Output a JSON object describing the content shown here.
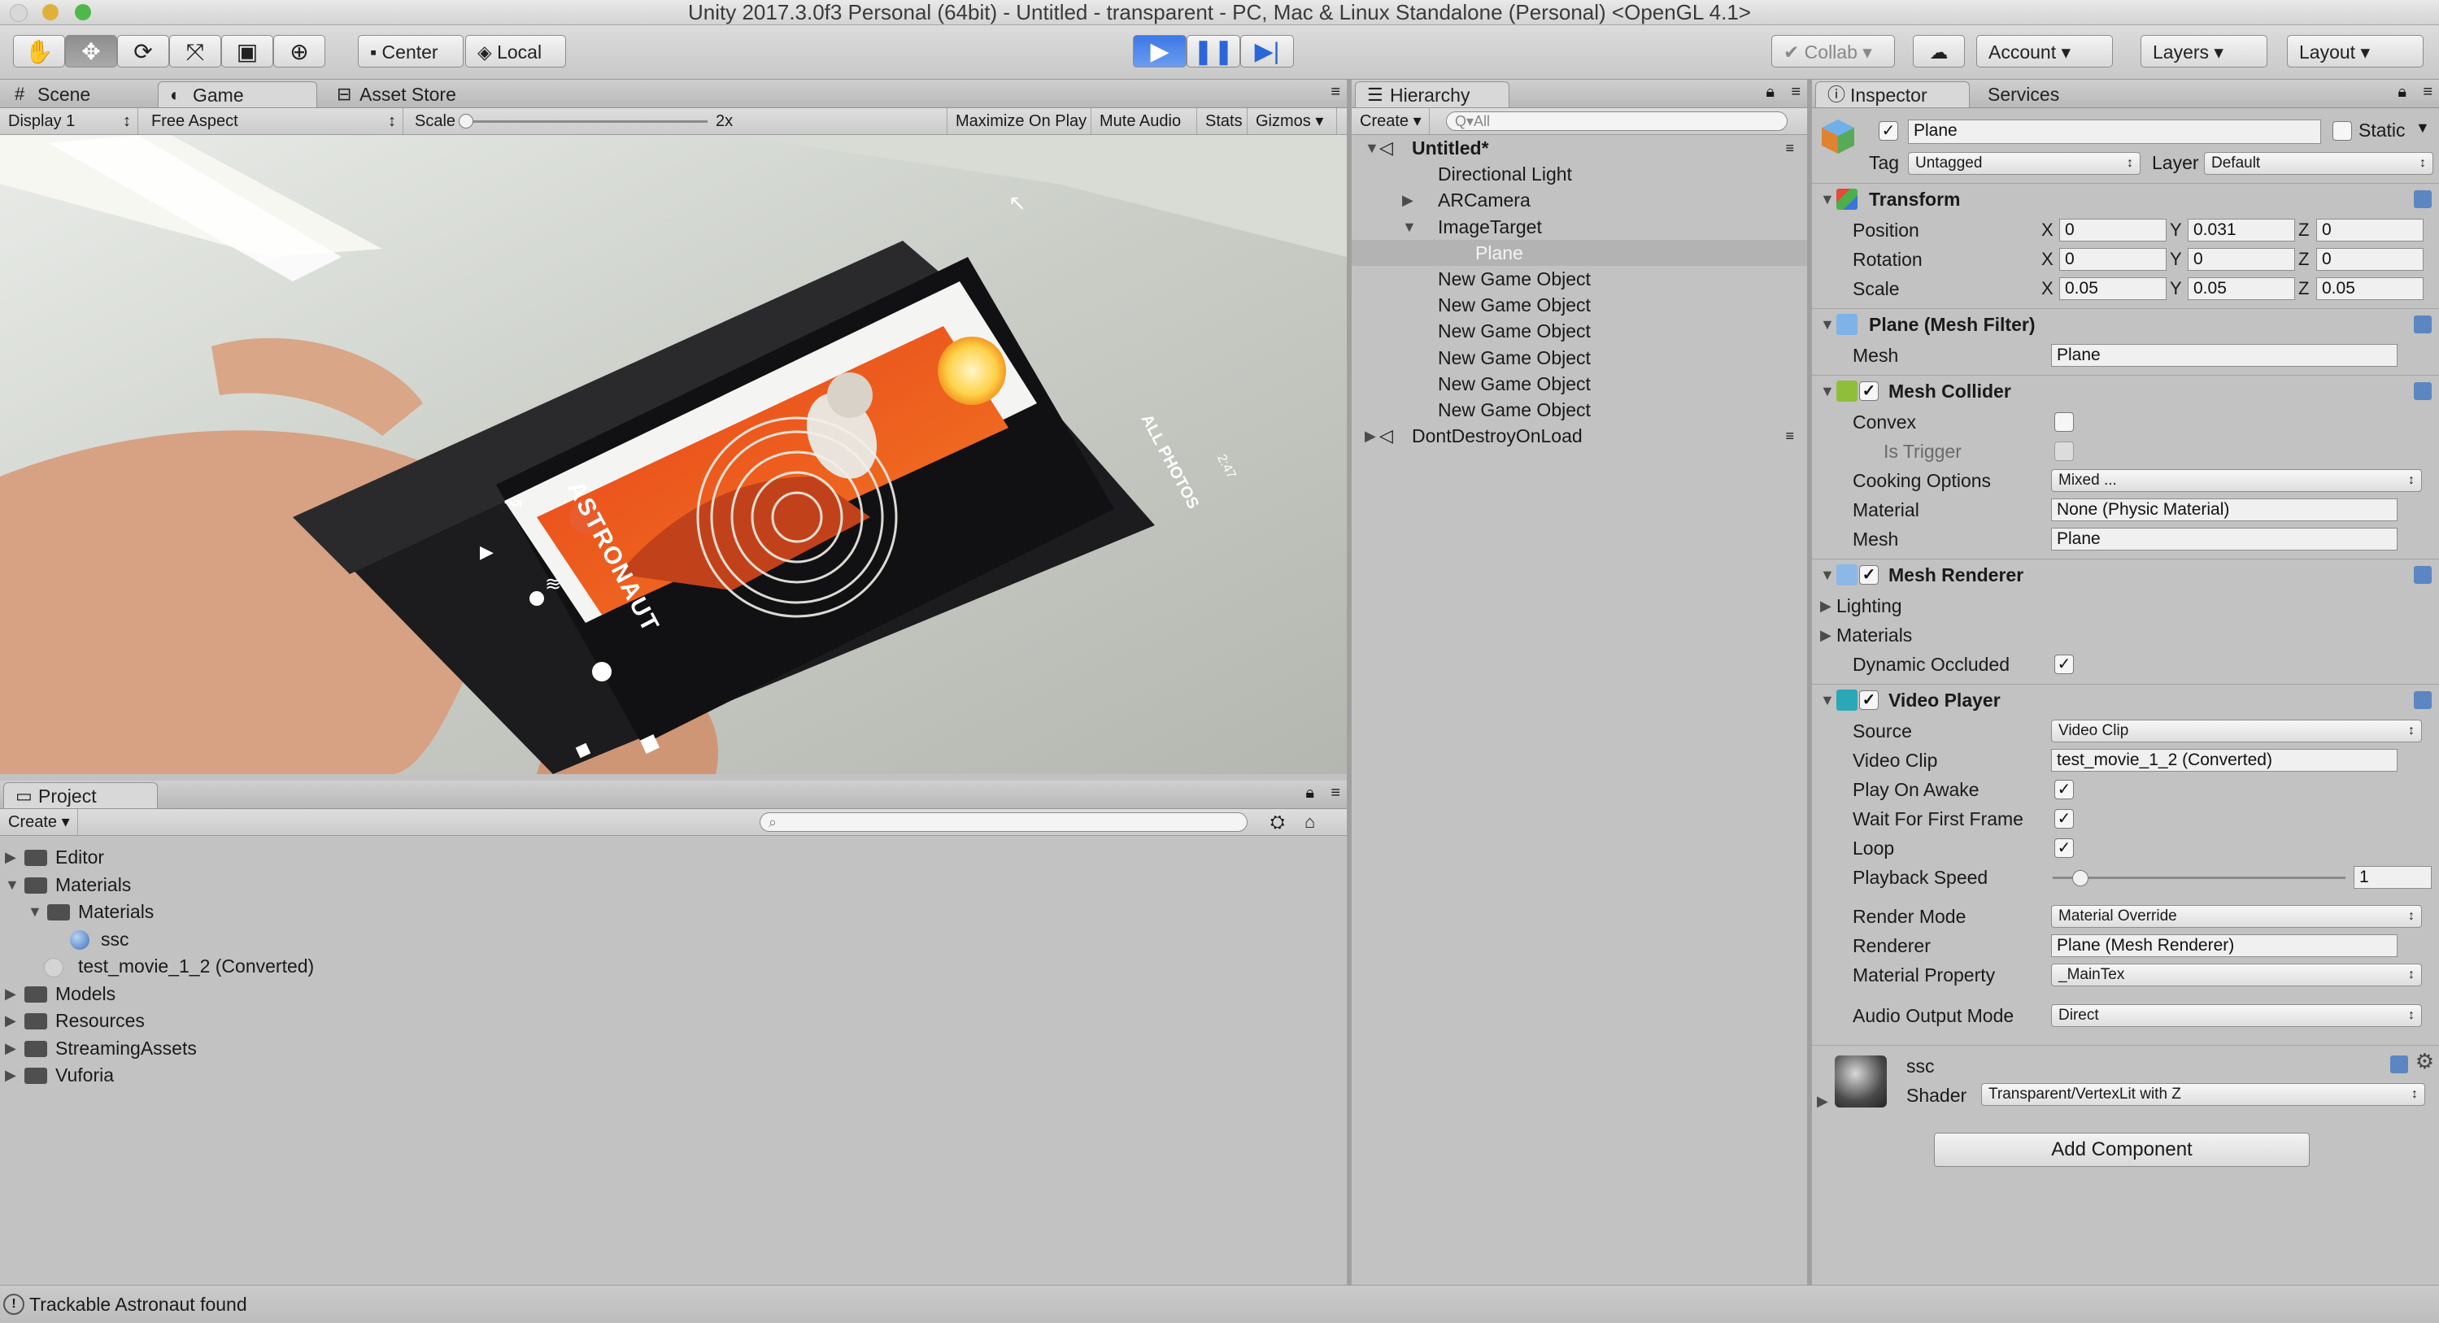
{
  "window": {
    "title": "Unity 2017.3.0f3 Personal (64bit) - Untitled - transparent - PC, Mac & Linux Standalone (Personal) <OpenGL 4.1>"
  },
  "toolbar": {
    "pivot_label": "Center",
    "space_label": "Local",
    "collab_label": "Collab",
    "account_label": "Account",
    "layers_label": "Layers",
    "layout_label": "Layout"
  },
  "game_panel": {
    "tabs": [
      "Scene",
      "Game",
      "Asset Store"
    ],
    "display": "Display 1",
    "aspect": "Free Aspect",
    "scale_label": "Scale",
    "scale_value": "2x",
    "buttons": [
      "Maximize On Play",
      "Mute Audio",
      "Stats",
      "Gizmos"
    ],
    "overlay": {
      "astronaut": "ASTRONAUT",
      "all_photos": "ALL PHOTOS",
      "time": "2:47"
    }
  },
  "hierarchy": {
    "tab": "Hierarchy",
    "create_label": "Create",
    "search_placeholder": "Q▾All",
    "items": [
      {
        "label": "Untitled*",
        "indent": 0,
        "arrow": "down",
        "scene": true
      },
      {
        "label": "Directional Light",
        "indent": 1
      },
      {
        "label": "ARCamera",
        "indent": 1,
        "arrow": "right"
      },
      {
        "label": "ImageTarget",
        "indent": 1,
        "arrow": "down"
      },
      {
        "label": "Plane",
        "indent": 2,
        "selected": true
      },
      {
        "label": "New Game Object",
        "indent": 1
      },
      {
        "label": "New Game Object",
        "indent": 1
      },
      {
        "label": "New Game Object",
        "indent": 1
      },
      {
        "label": "New Game Object",
        "indent": 1
      },
      {
        "label": "New Game Object",
        "indent": 1
      },
      {
        "label": "New Game Object",
        "indent": 1
      },
      {
        "label": "DontDestroyOnLoad",
        "indent": 0,
        "arrow": "right",
        "scene": true
      }
    ]
  },
  "project": {
    "tab": "Project",
    "create_label": "Create",
    "items": [
      {
        "label": "Editor",
        "indent": 0,
        "arrow": "right",
        "kind": "folder"
      },
      {
        "label": "Materials",
        "indent": 0,
        "arrow": "down",
        "kind": "folder"
      },
      {
        "label": "Materials",
        "indent": 1,
        "arrow": "down",
        "kind": "folder"
      },
      {
        "label": "ssc",
        "indent": 2,
        "kind": "material"
      },
      {
        "label": "test_movie_1_2 (Converted)",
        "indent": 1,
        "kind": "video"
      },
      {
        "label": "Models",
        "indent": 0,
        "arrow": "right",
        "kind": "folder"
      },
      {
        "label": "Resources",
        "indent": 0,
        "arrow": "right",
        "kind": "folder"
      },
      {
        "label": "StreamingAssets",
        "indent": 0,
        "arrow": "right",
        "kind": "folder"
      },
      {
        "label": "Vuforia",
        "indent": 0,
        "arrow": "right",
        "kind": "folder"
      }
    ]
  },
  "inspector": {
    "tabs": [
      "Inspector",
      "Services"
    ],
    "object_name": "Plane",
    "static_label": "Static",
    "tag_label": "Tag",
    "tag_value": "Untagged",
    "layer_label": "Layer",
    "layer_value": "Default",
    "transform": {
      "title": "Transform",
      "rows": [
        {
          "label": "Position",
          "x": "0",
          "y": "0.031",
          "z": "0"
        },
        {
          "label": "Rotation",
          "x": "0",
          "y": "0",
          "z": "0"
        },
        {
          "label": "Scale",
          "x": "0.05",
          "y": "0.05",
          "z": "0.05"
        }
      ]
    },
    "mesh_filter": {
      "title": "Plane (Mesh Filter)",
      "mesh_label": "Mesh",
      "mesh_value": "Plane"
    },
    "mesh_collider": {
      "title": "Mesh Collider",
      "convex": "Convex",
      "is_trigger": "Is Trigger",
      "cooking_label": "Cooking Options",
      "cooking_value": "Mixed ...",
      "material_label": "Material",
      "material_value": "None (Physic Material)",
      "mesh_label": "Mesh",
      "mesh_value": "Plane"
    },
    "mesh_renderer": {
      "title": "Mesh Renderer",
      "lighting": "Lighting",
      "materials": "Materials",
      "dynamic_occluded": "Dynamic Occluded"
    },
    "video_player": {
      "title": "Video Player",
      "source_label": "Source",
      "source_value": "Video Clip",
      "clip_label": "Video Clip",
      "clip_value": "test_movie_1_2 (Converted)",
      "play_on_awake": "Play On Awake",
      "wait_first_frame": "Wait For First Frame",
      "loop": "Loop",
      "speed_label": "Playback Speed",
      "speed_value": "1",
      "render_mode_label": "Render Mode",
      "render_mode_value": "Material Override",
      "renderer_label": "Renderer",
      "renderer_value": "Plane (Mesh Renderer)",
      "material_property_label": "Material Property",
      "material_property_value": "_MainTex",
      "audio_label": "Audio Output Mode",
      "audio_value": "Direct"
    },
    "material": {
      "name": "ssc",
      "shader_label": "Shader",
      "shader_value": "Transparent/VertexLit with Z"
    },
    "add_component": "Add Component"
  },
  "status": {
    "message": "Trackable Astronaut found"
  },
  "colors": {
    "play_accent": "#3d78e6",
    "selection": "#b3b3b3",
    "panel_bg": "#c2c2c2"
  }
}
